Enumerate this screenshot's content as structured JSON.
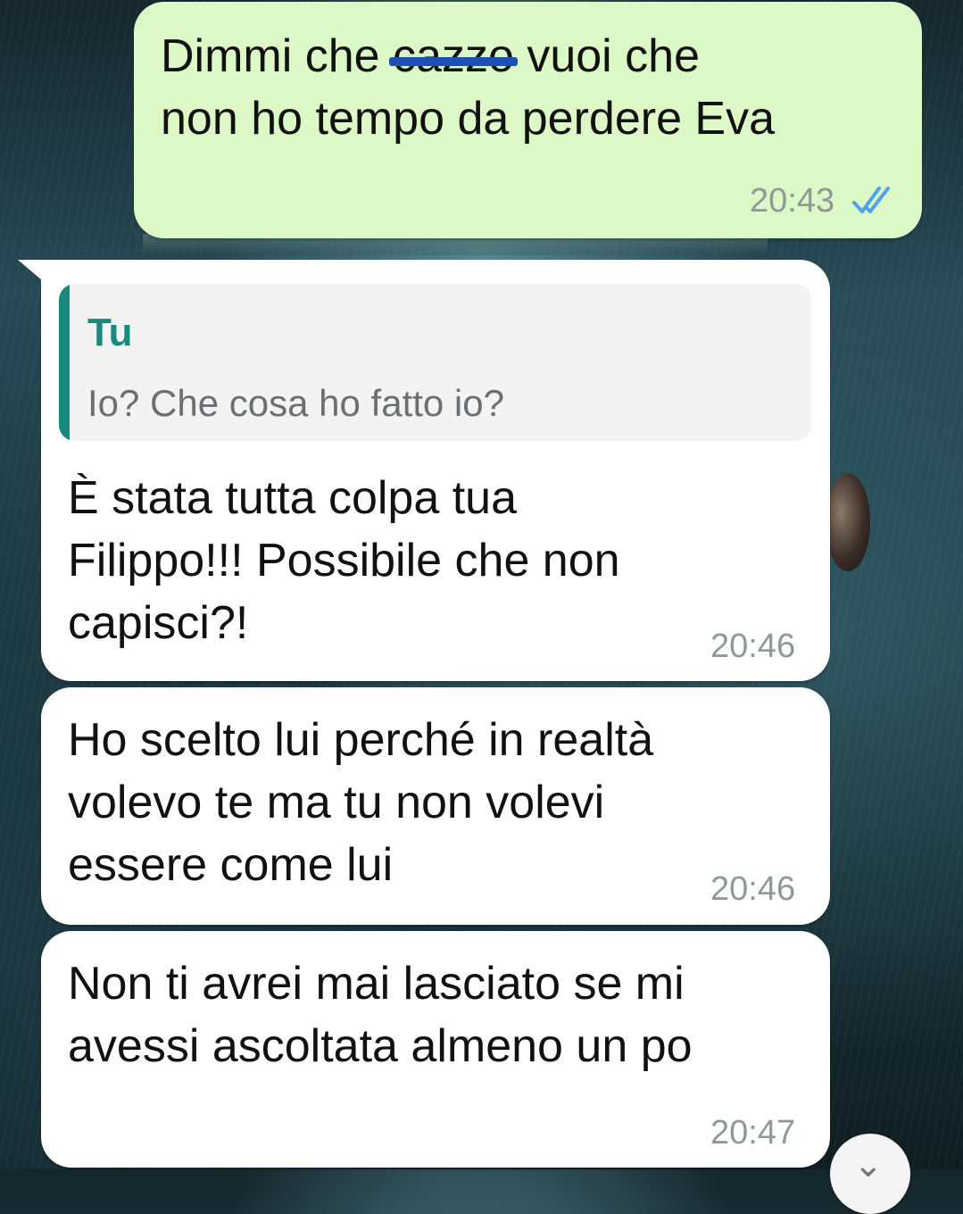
{
  "colors": {
    "outgoing_bubble": "#dcf8c6",
    "incoming_bubble": "#ffffff",
    "read_ticks": "#4fa3e8",
    "quote_accent": "#168a7d",
    "strike_mark": "#1e4fb3"
  },
  "messages": [
    {
      "direction": "outgoing",
      "text_before": "Dimmi che ",
      "struck_word": "cazzo",
      "text_after": " vuoi che\nnon ho tempo da perdere Eva",
      "time": "20:43",
      "status_icon": "double-check-read-icon"
    },
    {
      "direction": "incoming",
      "quote": {
        "author": "Tu",
        "text": "Io? Che cosa ho fatto io?"
      },
      "text": "È stata tutta colpa tua\nFilippo!!! Possibile che non\ncapisci?!",
      "time": "20:46"
    },
    {
      "direction": "incoming",
      "text": "Ho scelto lui perché in realtà\nvolevo te ma tu non volevi\nessere come lui",
      "time": "20:46"
    },
    {
      "direction": "incoming",
      "text": "Non ti avrei mai lasciato se mi\navessi ascoltata almeno un po",
      "time": "20:47"
    }
  ],
  "scroll_button_icon": "chevron-down-icon"
}
